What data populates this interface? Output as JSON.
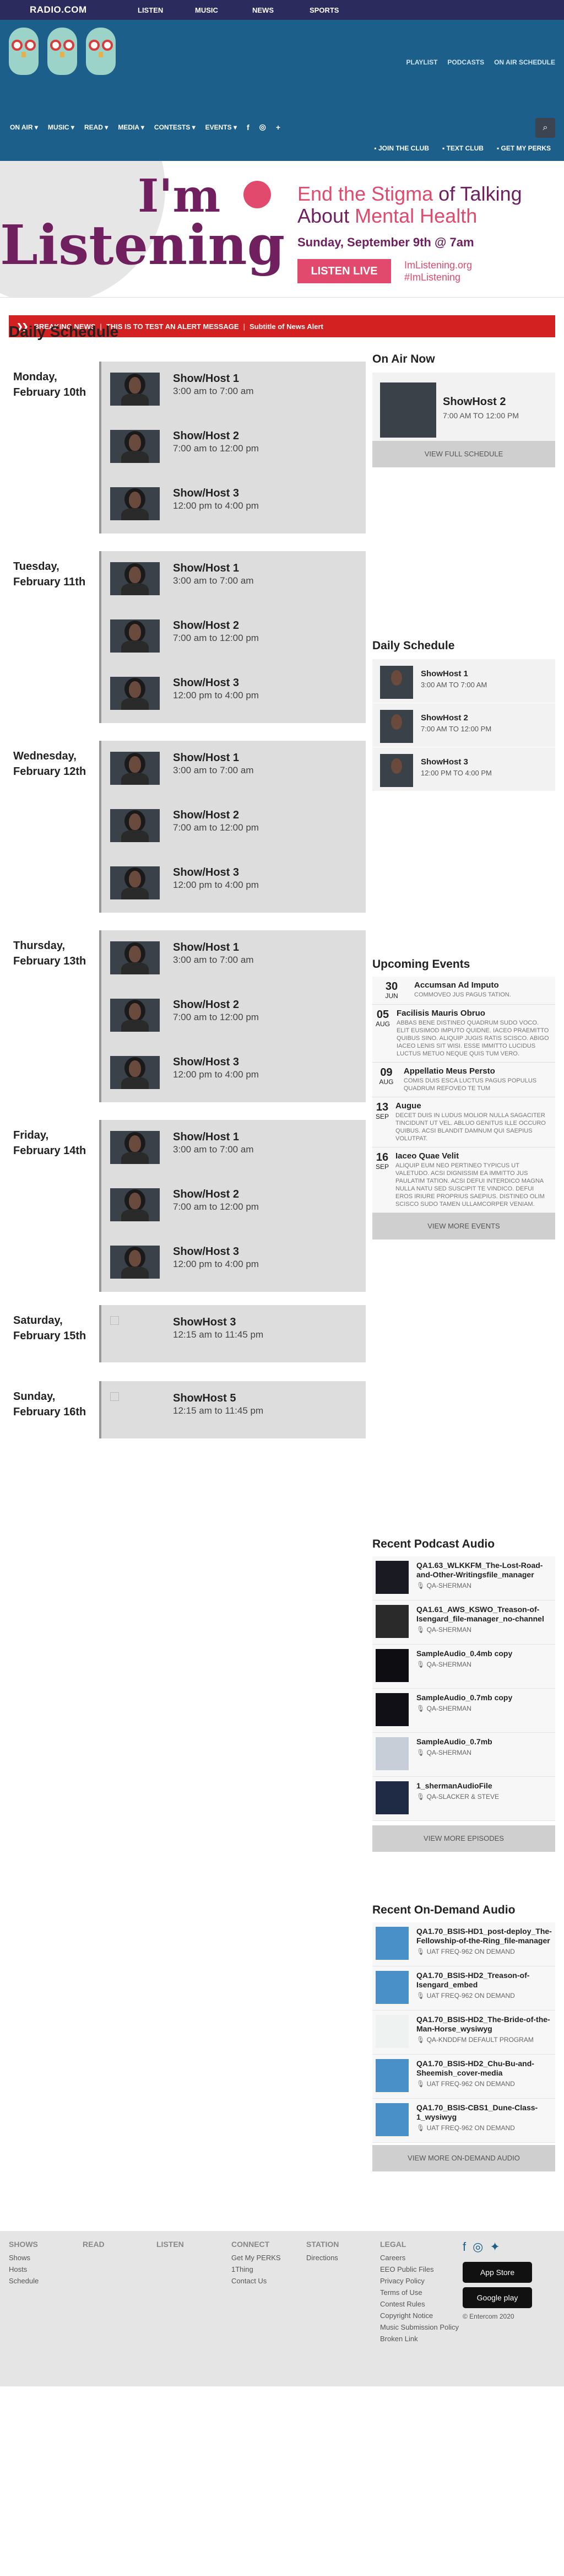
{
  "logo": "RADIO.COM",
  "topnav": [
    "LISTEN",
    "MUSIC",
    "NEWS",
    "SPORTS"
  ],
  "header_links": [
    "PLAYLIST",
    "PODCASTS",
    "ON AIR SCHEDULE"
  ],
  "mainnav": [
    "ON AIR",
    "MUSIC",
    "READ",
    "MEDIA",
    "CONTESTS",
    "EVENTS"
  ],
  "subnav": [
    "JOIN THE CLUB",
    "TEXT CLUB",
    "GET MY PERKS"
  ],
  "banner": {
    "im": "I'm",
    "listening": "Listening",
    "line1": "End the Stigma",
    "line1b": "of Talking",
    "line2": "About",
    "line2b": "Mental Health",
    "date": "Sunday, September 9th @ 7am",
    "cta": "LISTEN LIVE",
    "web1": "ImListening.org",
    "web2": "#ImListening"
  },
  "alert": {
    "label": "BREAKING NEWS",
    "msg": "THIS IS TO TEST AN ALERT MESSAGE",
    "sub": "Subtitle of News Alert"
  },
  "schedule_title": "Daily Schedule",
  "days": [
    {
      "day": "Monday,",
      "date": "February 10th",
      "shows": [
        {
          "name": "Show/Host 1",
          "time": "3:00 am to 7:00 am"
        },
        {
          "name": "Show/Host 2",
          "time": "7:00 am to 12:00 pm"
        },
        {
          "name": "Show/Host 3",
          "time": "12:00 pm to 4:00 pm"
        }
      ]
    },
    {
      "day": "Tuesday,",
      "date": "February 11th",
      "shows": [
        {
          "name": "Show/Host 1",
          "time": "3:00 am to 7:00 am"
        },
        {
          "name": "Show/Host 2",
          "time": "7:00 am to 12:00 pm"
        },
        {
          "name": "Show/Host 3",
          "time": "12:00 pm to 4:00 pm"
        }
      ]
    },
    {
      "day": "Wednesday,",
      "date": "February 12th",
      "shows": [
        {
          "name": "Show/Host 1",
          "time": "3:00 am to 7:00 am"
        },
        {
          "name": "Show/Host 2",
          "time": "7:00 am to 12:00 pm"
        },
        {
          "name": "Show/Host 3",
          "time": "12:00 pm to 4:00 pm"
        }
      ]
    },
    {
      "day": "Thursday,",
      "date": "February 13th",
      "shows": [
        {
          "name": "Show/Host 1",
          "time": "3:00 am to 7:00 am"
        },
        {
          "name": "Show/Host 2",
          "time": "7:00 am to 12:00 pm"
        },
        {
          "name": "Show/Host 3",
          "time": "12:00 pm to 4:00 pm"
        }
      ]
    },
    {
      "day": "Friday,",
      "date": "February 14th",
      "shows": [
        {
          "name": "Show/Host 1",
          "time": "3:00 am to 7:00 am"
        },
        {
          "name": "Show/Host 2",
          "time": "7:00 am to 12:00 pm"
        },
        {
          "name": "Show/Host 3",
          "time": "12:00 pm to 4:00 pm"
        }
      ]
    },
    {
      "day": "Saturday,",
      "date": "February 15th",
      "shows": [
        {
          "name": "ShowHost 3",
          "time": "12:15 am to 11:45 pm",
          "broken": true
        }
      ]
    },
    {
      "day": "Sunday,",
      "date": "February 16th",
      "shows": [
        {
          "name": "ShowHost 5",
          "time": "12:15 am to 11:45 pm",
          "broken": true
        }
      ]
    }
  ],
  "on_air": {
    "title": "On Air Now",
    "name": "ShowHost 2",
    "time": "7:00 AM TO 12:00 PM",
    "button": "VIEW FULL SCHEDULE"
  },
  "daily": {
    "title": "Daily Schedule",
    "items": [
      {
        "name": "ShowHost 1",
        "time": "3:00 AM TO 7:00 AM"
      },
      {
        "name": "ShowHost 2",
        "time": "7:00 AM TO 12:00 PM"
      },
      {
        "name": "ShowHost 3",
        "time": "12:00 PM TO 4:00 PM"
      }
    ]
  },
  "events": {
    "title": "Upcoming Events",
    "button": "VIEW MORE EVENTS",
    "items": [
      {
        "d": "30",
        "m": "JUN",
        "t": "Accumsan Ad Imputo",
        "desc": "Commoveo Jus Pagus Tation."
      },
      {
        "d": "05",
        "m": "AUG",
        "t": "Facilisis Mauris Obruo",
        "desc": "Abbas Bene Distineo Quadrum Sudo Voco. Elit Eusimod Imputo Quidne. Iaceo Praemitto Quibus Sino. Aliquip Jugis Ratis Scisco. Abigo Iaceo Lenis Sit Wisi. Esse Immitto Lucidus Luctus Metuo Neque Quis Tum Vero."
      },
      {
        "d": "09",
        "m": "AUG",
        "t": "Appellatio Meus Persto",
        "desc": "Comis Duis Esca Luctus Pagus Populus Quadrum Refoveo Te Tum"
      },
      {
        "d": "13",
        "m": "SEP",
        "t": "Augue",
        "desc": "Decet Duis In Ludus Molior Nulla Sagaciter Tincidunt Ut Vel. Abluo Genitus Ille Occuro Quibus. Acsi Blandit Damnum Qui Saepius Volutpat."
      },
      {
        "d": "16",
        "m": "SEP",
        "t": "Iaceo Quae Velit",
        "desc": "Aliquip Eum Neo Pertineo Typicus Ut Valetudo. Acsi Dignissim Ea Immitto Jus Paulatim Tation. Acsi Defui Interdico Magna Nulla Natu Sed Suscipit Te Vindico. Defui Eros Iriure Proprius Saepius. Distineo Olim Scisco Sudo Tamen Ullamcorper Veniam."
      }
    ]
  },
  "podcasts": {
    "title": "Recent Podcast Audio",
    "button": "VIEW MORE EPISODES",
    "items": [
      {
        "t": "QA1.63_WLKKFM_The-Lost-Road-and-Other-Writingsfile_manager",
        "a": "QA-SHERMAN"
      },
      {
        "t": "QA1.61_AWS_KSWO_Treason-of-Isengard_file-manager_no-channel",
        "a": "QA-SHERMAN"
      },
      {
        "t": "SampleAudio_0.4mb copy",
        "a": "QA-SHERMAN"
      },
      {
        "t": "SampleAudio_0.7mb copy",
        "a": "QA-SHERMAN"
      },
      {
        "t": "SampleAudio_0.7mb",
        "a": "QA-SHERMAN"
      },
      {
        "t": "1_shermanAudioFile",
        "a": "QA-SLACKER & STEVE"
      }
    ]
  },
  "ondemand": {
    "title": "Recent On-Demand Audio",
    "button": "VIEW MORE ON-DEMAND AUDIO",
    "items": [
      {
        "t": "QA1.70_BSIS-HD1_post-deploy_The-Fellowship-of-the-Ring_file-manager",
        "a": "UAT FREQ-962 ON DEMAND"
      },
      {
        "t": "QA1.70_BSIS-HD2_Treason-of-Isengard_embed",
        "a": "UAT FREQ-962 ON DEMAND"
      },
      {
        "t": "QA1.70_BSIS-HD2_The-Bride-of-the-Man-Horse_wysiwyg",
        "a": "QA-KNDDFM DEFAULT PROGRAM"
      },
      {
        "t": "QA1.70_BSIS-HD2_Chu-Bu-and-Sheemish_cover-media",
        "a": "UAT FREQ-962 ON DEMAND"
      },
      {
        "t": "QA1.70_BSIS-CBS1_Dune-Class-1_wysiwyg",
        "a": "UAT FREQ-962 ON DEMAND"
      }
    ]
  },
  "footer": {
    "shows": {
      "h": "SHOWS",
      "items": [
        "Shows",
        "Hosts",
        "Schedule"
      ]
    },
    "read": {
      "h": "READ",
      "items": []
    },
    "listen": {
      "h": "LISTEN",
      "items": []
    },
    "connect": {
      "h": "CONNECT",
      "items": [
        "Get My PERKS",
        "1Thing",
        "Contact Us"
      ]
    },
    "station": {
      "h": "STATION",
      "items": [
        "Directions"
      ]
    },
    "legal": {
      "h": "LEGAL",
      "items": [
        "Careers",
        "EEO Public Files",
        "Privacy Policy",
        "Terms of Use",
        "Contest Rules",
        "Copyright Notice",
        "Music Submission Policy",
        "Broken Link"
      ]
    },
    "appstore": "App Store",
    "googleplay": "Google play",
    "copyright": "© Entercom 2020"
  }
}
